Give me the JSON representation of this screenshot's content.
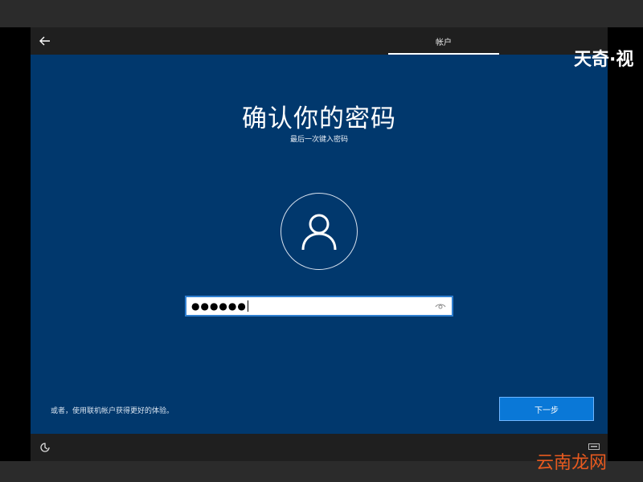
{
  "window": {
    "tab_label": "帐户",
    "title": "确认你的密码",
    "subtitle": "最后一次键入密码"
  },
  "password": {
    "masked_value": "●●●●●●"
  },
  "footer": {
    "online_account_link": "或者，使用联机帐户获得更好的体验。",
    "next_button": "下一步"
  },
  "watermarks": {
    "top_right": "天奇·视",
    "bottom_right": "云南龙网"
  },
  "icons": {
    "back": "arrow-left-icon",
    "avatar": "user-icon",
    "reveal": "eye-icon",
    "ease_of_access": "ease-of-access-icon",
    "keyboard": "keyboard-icon"
  },
  "colors": {
    "window_bg": "#01386d",
    "button_bg": "#0a78d7",
    "field_border": "#2f7fd0",
    "watermark_orange": "#e85a1f"
  }
}
